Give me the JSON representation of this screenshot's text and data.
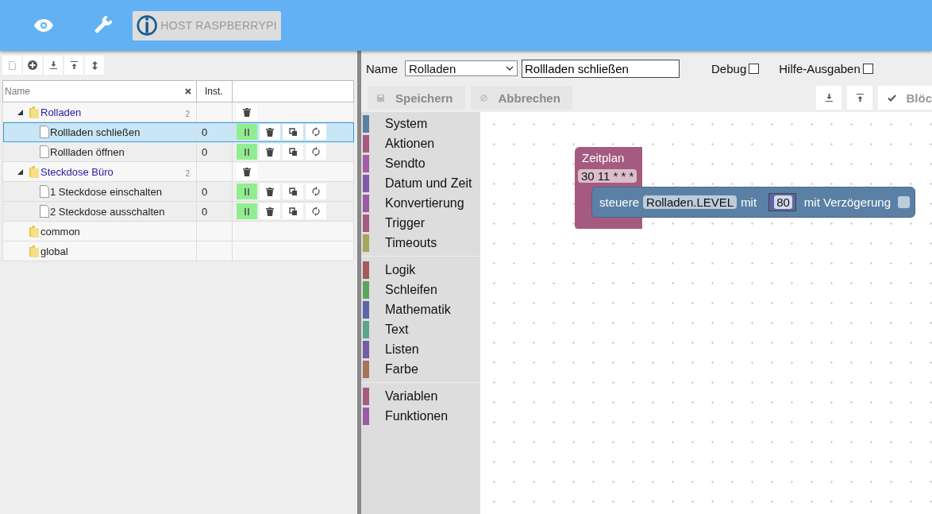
{
  "header": {
    "host_button": "HOST RASPBERRYPI"
  },
  "tree": {
    "columns": [
      {
        "label": "Name"
      },
      {
        "label": "Inst."
      }
    ],
    "rows": [
      {
        "kind": "folder",
        "name": "Rolladen",
        "count": "2",
        "expanded": true,
        "children": [
          {
            "name": "Rollladen schließen",
            "instances": "0",
            "selected": true,
            "running": true
          },
          {
            "name": "Rollladen öffnen",
            "instances": "0",
            "selected": false,
            "running": true
          }
        ]
      },
      {
        "kind": "folder",
        "name": "Steckdose Büro",
        "count": "2",
        "expanded": true,
        "children": [
          {
            "name": "1 Steckdose einschalten",
            "instances": "0",
            "selected": false,
            "running": true
          },
          {
            "name": "2 Steckdose ausschalten",
            "instances": "0",
            "selected": false,
            "running": true
          }
        ]
      },
      {
        "kind": "group",
        "name": "common"
      },
      {
        "kind": "group",
        "name": "global"
      }
    ]
  },
  "editor": {
    "name_label": "Name",
    "group_value": "Rolladen",
    "script_name": "Rollladen schließen",
    "options": [
      {
        "label": "Debug",
        "checked": false
      },
      {
        "label": "Hilfe-Ausgaben",
        "checked": false
      }
    ],
    "buttons": [
      {
        "kind": "save",
        "label": "Speichern",
        "disabled": true
      },
      {
        "kind": "cancel",
        "label": "Abbrechen",
        "disabled": true
      }
    ],
    "check_button": "Blöc"
  },
  "toolbox": {
    "groups": [
      {
        "items": [
          {
            "label": "System",
            "color": "#5b80a5"
          },
          {
            "label": "Aktionen",
            "color": "#a55b80"
          },
          {
            "label": "Sendto",
            "color": "#a55ba5"
          },
          {
            "label": "Datum und Zeit",
            "color": "#805ba5"
          },
          {
            "label": "Konvertierung",
            "color": "#995ba5"
          },
          {
            "label": "Trigger",
            "color": "#a55b80"
          },
          {
            "label": "Timeouts",
            "color": "#a5a55b"
          }
        ]
      },
      {
        "items": [
          {
            "label": "Logik",
            "color": "#a55b5b"
          },
          {
            "label": "Schleifen",
            "color": "#5ba55b"
          },
          {
            "label": "Mathematik",
            "color": "#5b67a5"
          },
          {
            "label": "Text",
            "color": "#5ba58c"
          },
          {
            "label": "Listen",
            "color": "#745ba5"
          },
          {
            "label": "Farbe",
            "color": "#a5745b"
          }
        ]
      },
      {
        "items": [
          {
            "label": "Variablen",
            "color": "#a55b80"
          },
          {
            "label": "Funktionen",
            "color": "#995ba5"
          }
        ]
      }
    ]
  },
  "workspace": {
    "schedule": {
      "title": "Zeitplan",
      "cron": "30 11 * * *"
    },
    "control": {
      "label": "steuere",
      "object": "Rolladen.LEVEL",
      "with": "mit",
      "value": "80",
      "delay_label": "mit Verzögerung",
      "delay_checked": false
    }
  }
}
